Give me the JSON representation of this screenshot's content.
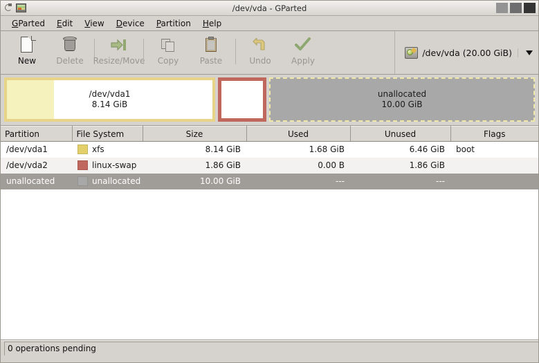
{
  "window": {
    "title": "/dev/vda - GParted",
    "menu_icon": "window-menu-icon",
    "app_icon": "gparted-app-icon",
    "buttons": [
      {
        "name": "minimize",
        "label": ""
      },
      {
        "name": "maximize",
        "label": ""
      },
      {
        "name": "close",
        "label": ""
      }
    ]
  },
  "menubar": {
    "items": [
      {
        "mnemonic": "G",
        "rest": "Parted"
      },
      {
        "mnemonic": "E",
        "rest": "dit"
      },
      {
        "mnemonic": "V",
        "rest": "iew"
      },
      {
        "mnemonic": "D",
        "rest": "evice"
      },
      {
        "mnemonic": "P",
        "rest": "artition"
      },
      {
        "mnemonic": "H",
        "rest": "elp"
      }
    ]
  },
  "toolbar": {
    "buttons": [
      {
        "label": "New",
        "icon": "new-document-icon",
        "enabled": true
      },
      {
        "label": "Delete",
        "icon": "trash-icon",
        "enabled": false
      },
      {
        "label": "Resize/Move",
        "icon": "resize-move-icon",
        "enabled": false
      },
      {
        "label": "Copy",
        "icon": "copy-icon",
        "enabled": false
      },
      {
        "label": "Paste",
        "icon": "paste-icon",
        "enabled": false
      },
      {
        "label": "Undo",
        "icon": "undo-icon",
        "enabled": false
      },
      {
        "label": "Apply",
        "icon": "apply-check-icon",
        "enabled": false
      }
    ],
    "device_selector": {
      "icon": "hard-disk-icon",
      "label": "/dev/vda  (20.00 GiB)",
      "arrow": "chevron-down-icon"
    }
  },
  "graphic": {
    "partitions": [
      {
        "name": "/dev/vda1",
        "size": "8.14 GiB",
        "border_color": "#e8d488",
        "fill_color": "#ffffff",
        "used_color": "#f6f2bd",
        "used_fraction": 0.21
      },
      {
        "name": "",
        "size": "",
        "border_color": "#c1685e",
        "fill_color": "#ffffff"
      },
      {
        "name": "unallocated",
        "size": "10.00 GiB",
        "border_color": "#efe8a8",
        "fill_color": "#a8a8a8"
      }
    ]
  },
  "table": {
    "headers": [
      "Partition",
      "File System",
      "Size",
      "Used",
      "Unused",
      "Flags"
    ],
    "rows": [
      {
        "partition": "/dev/vda1",
        "filesystem": "xfs",
        "swatch": "#e4d06a",
        "size": "8.14 GiB",
        "used": "1.68 GiB",
        "unused": "6.46 GiB",
        "flags": "boot",
        "selected": false
      },
      {
        "partition": "/dev/vda2",
        "filesystem": "linux-swap",
        "swatch": "#c1685e",
        "size": "1.86 GiB",
        "used": "0.00 B",
        "unused": "1.86 GiB",
        "flags": "",
        "selected": false
      },
      {
        "partition": "unallocated",
        "filesystem": "unallocated",
        "swatch": "#a8a8a8",
        "size": "10.00 GiB",
        "used": "---",
        "unused": "---",
        "flags": "",
        "selected": true
      }
    ]
  },
  "statusbar": {
    "text": "0 operations pending"
  }
}
